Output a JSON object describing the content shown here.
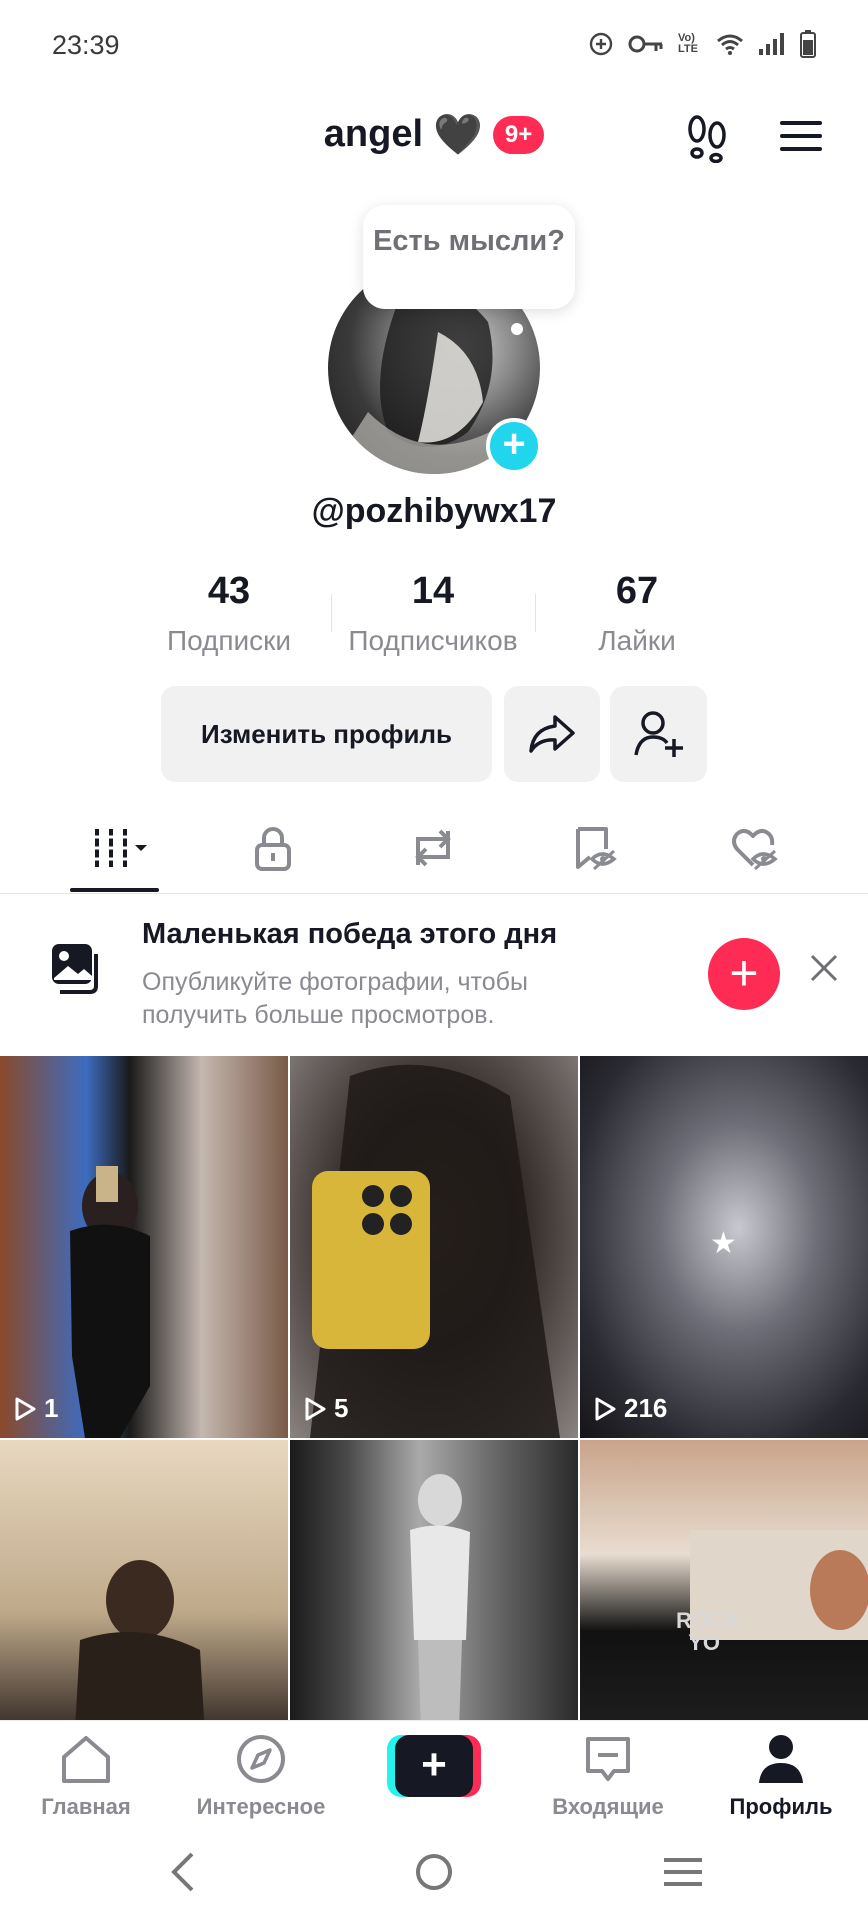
{
  "status_bar": {
    "time": "23:39",
    "icons": [
      "data-saver-icon",
      "vpn-key-icon",
      "volte-icon",
      "wifi-icon",
      "signal-icon",
      "battery-icon"
    ],
    "volte_text": "Vo) LTE"
  },
  "header": {
    "title": "angel",
    "title_emoji": "🖤",
    "notification_badge": "9+",
    "icons": [
      "footprints-icon",
      "menu-icon"
    ]
  },
  "profile": {
    "thought_bubble": "Есть мысли?",
    "username": "@pozhibywx17",
    "stats": [
      {
        "value": "43",
        "label": "Подписки"
      },
      {
        "value": "14",
        "label": "Подписчиков"
      },
      {
        "value": "67",
        "label": "Лайки"
      }
    ],
    "edit_button": "Изменить профиль"
  },
  "tabs": [
    {
      "name": "videos",
      "icon": "grid-icon",
      "active": true
    },
    {
      "name": "private",
      "icon": "lock-icon",
      "active": false
    },
    {
      "name": "reposts",
      "icon": "repost-icon",
      "active": false
    },
    {
      "name": "favorites",
      "icon": "bookmark-hidden-icon",
      "active": false
    },
    {
      "name": "liked",
      "icon": "heart-hidden-icon",
      "active": false
    }
  ],
  "banner": {
    "title": "Маленькая победа этого дня",
    "subtitle": "Опубликуйте фотографии, чтобы получить больше просмотров."
  },
  "videos": [
    {
      "views": "1"
    },
    {
      "views": "5"
    },
    {
      "views": "216"
    },
    {
      "views": ""
    },
    {
      "views": ""
    },
    {
      "views": "",
      "overlay_text": "ROCK\nYO"
    }
  ],
  "bottom_nav": [
    {
      "label": "Главная",
      "icon": "home-icon",
      "active": false
    },
    {
      "label": "Интересное",
      "icon": "compass-icon",
      "active": false
    },
    {
      "label": "",
      "icon": "create-plus-icon",
      "active": false
    },
    {
      "label": "Входящие",
      "icon": "inbox-icon",
      "active": false
    },
    {
      "label": "Профиль",
      "icon": "profile-icon",
      "active": true
    }
  ],
  "colors": {
    "accent_red": "#fe2c55",
    "accent_cyan": "#20d5ec",
    "text_primary": "#161823",
    "text_secondary": "#8a8b91"
  }
}
